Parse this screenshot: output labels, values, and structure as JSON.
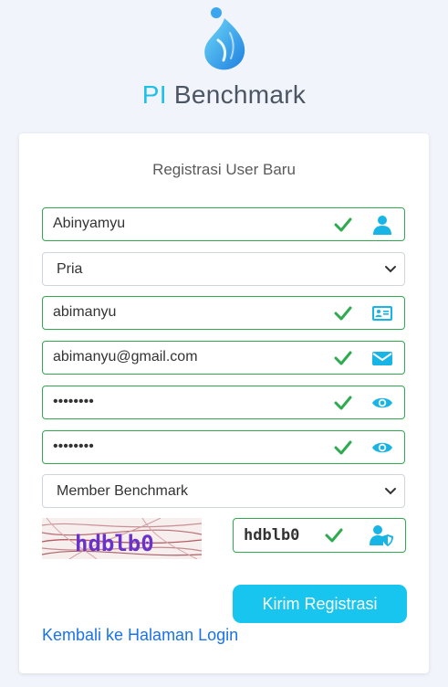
{
  "brand": {
    "prefix": "PI",
    "name": "Benchmark"
  },
  "form": {
    "title": "Registrasi User Baru",
    "full_name": "Abinyamyu",
    "gender": "Pria",
    "username": "abimanyu",
    "email": "abimanyu@gmail.com",
    "password": "••••••••",
    "password_confirm": "••••••••",
    "member_type": "Member Benchmark",
    "captcha_text": "hdblb0",
    "captcha_input": "hdblb0",
    "submit_label": "Kirim Registrasi",
    "back_link": "Kembali ke Halaman Login"
  },
  "colors": {
    "accent": "#17c5ef",
    "valid": "#2eaa4f",
    "link": "#1a73e8"
  },
  "icons": [
    "user-icon",
    "id-card-icon",
    "envelope-icon",
    "eye-icon",
    "user-shield-icon",
    "check-icon",
    "chevron-down-icon"
  ]
}
